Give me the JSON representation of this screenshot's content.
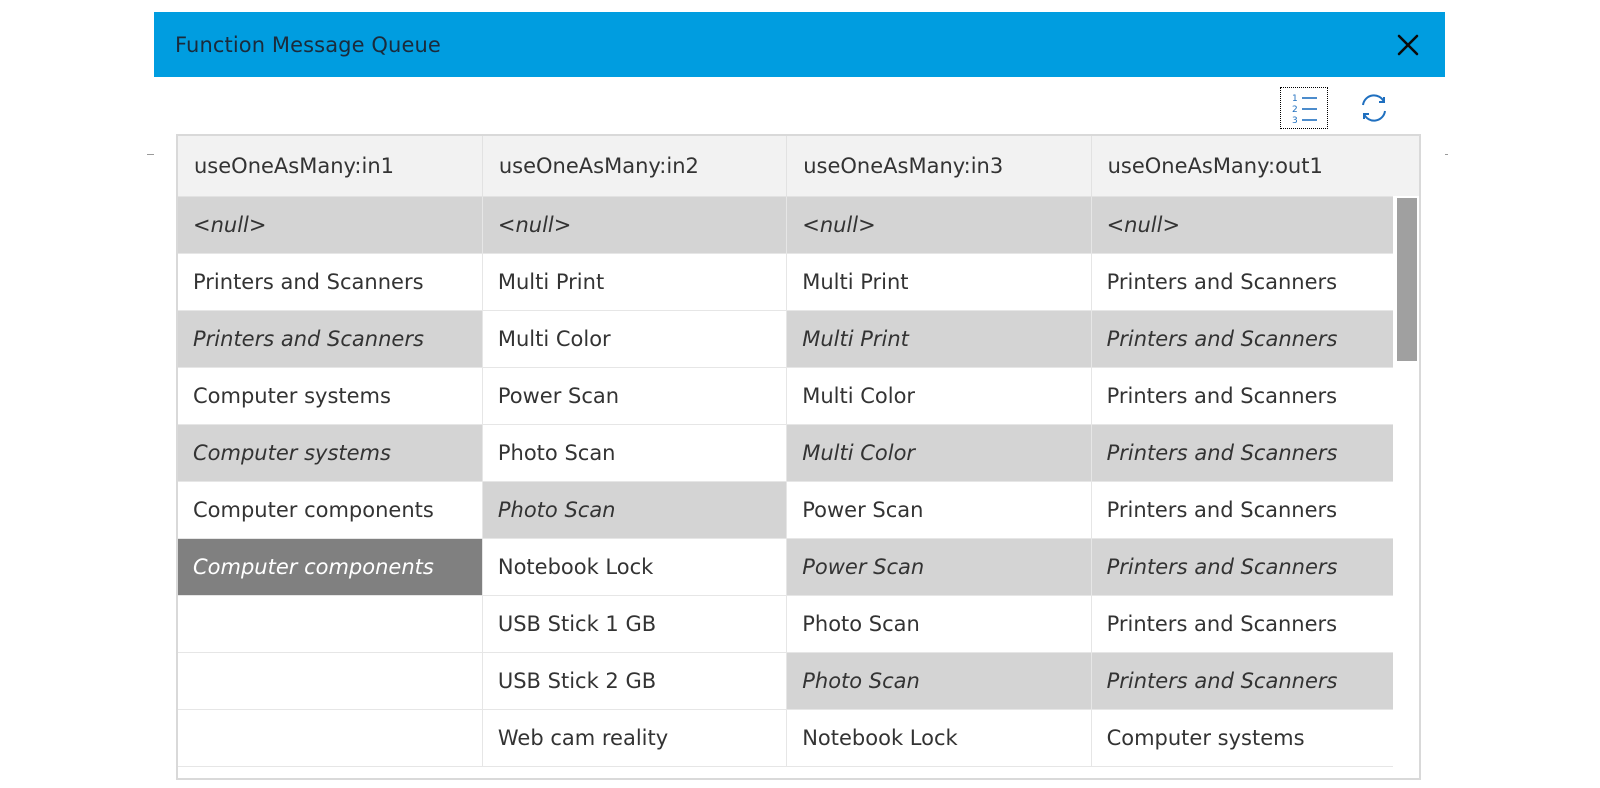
{
  "dialog": {
    "title": "Function Message Queue",
    "close_icon": "close-icon",
    "toolbar": {
      "line_numbers_icon": "numbered-list-icon",
      "refresh_icon": "refresh-icon"
    }
  },
  "table": {
    "columns": [
      "useOneAsMany:in1",
      "useOneAsMany:in2",
      "useOneAsMany:in3",
      "useOneAsMany:out1"
    ],
    "rows": [
      [
        {
          "text": "<null>",
          "style": "dup"
        },
        {
          "text": "<null>",
          "style": "dup"
        },
        {
          "text": "<null>",
          "style": "dup"
        },
        {
          "text": "<null>",
          "style": "dup"
        }
      ],
      [
        {
          "text": "Printers and Scanners",
          "style": ""
        },
        {
          "text": "Multi Print",
          "style": ""
        },
        {
          "text": "Multi Print",
          "style": ""
        },
        {
          "text": "Printers and Scanners",
          "style": ""
        }
      ],
      [
        {
          "text": "Printers and Scanners",
          "style": "dup"
        },
        {
          "text": "Multi Color",
          "style": ""
        },
        {
          "text": "Multi Print",
          "style": "dup"
        },
        {
          "text": "Printers and Scanners",
          "style": "dup"
        }
      ],
      [
        {
          "text": "Computer systems",
          "style": ""
        },
        {
          "text": "Power Scan",
          "style": ""
        },
        {
          "text": "Multi Color",
          "style": ""
        },
        {
          "text": "Printers and Scanners",
          "style": ""
        }
      ],
      [
        {
          "text": "Computer systems",
          "style": "dup"
        },
        {
          "text": "Photo Scan",
          "style": ""
        },
        {
          "text": "Multi Color",
          "style": "dup"
        },
        {
          "text": "Printers and Scanners",
          "style": "dup"
        }
      ],
      [
        {
          "text": "Computer components",
          "style": ""
        },
        {
          "text": "Photo Scan",
          "style": "dup"
        },
        {
          "text": "Power Scan",
          "style": ""
        },
        {
          "text": "Printers and Scanners",
          "style": ""
        }
      ],
      [
        {
          "text": "Computer components",
          "style": "sel"
        },
        {
          "text": "Notebook Lock",
          "style": ""
        },
        {
          "text": "Power Scan",
          "style": "dup"
        },
        {
          "text": "Printers and Scanners",
          "style": "dup"
        }
      ],
      [
        {
          "text": "",
          "style": ""
        },
        {
          "text": "USB Stick 1 GB",
          "style": ""
        },
        {
          "text": "Photo Scan",
          "style": ""
        },
        {
          "text": "Printers and Scanners",
          "style": ""
        }
      ],
      [
        {
          "text": "",
          "style": ""
        },
        {
          "text": "USB Stick 2 GB",
          "style": ""
        },
        {
          "text": "Photo Scan",
          "style": "dup"
        },
        {
          "text": "Printers and Scanners",
          "style": "dup"
        }
      ],
      [
        {
          "text": "",
          "style": ""
        },
        {
          "text": "Web cam reality",
          "style": ""
        },
        {
          "text": "Notebook Lock",
          "style": ""
        },
        {
          "text": "Computer systems",
          "style": ""
        }
      ]
    ]
  },
  "colors": {
    "title_bar": "#009de0",
    "duplicate_cell": "#d4d4d4",
    "selected_cell": "#808080",
    "icon_blue": "#1f6fbf"
  }
}
